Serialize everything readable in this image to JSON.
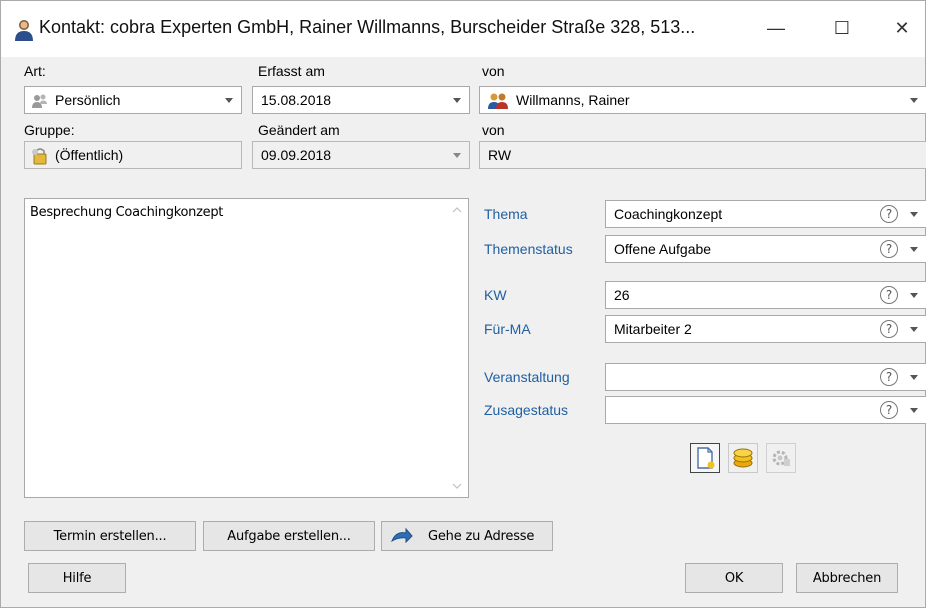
{
  "window": {
    "title": "Kontakt: cobra Experten GmbH, Rainer Willmanns, Burscheider Straße 328,  513...",
    "minimize": "—",
    "maximize": "☐",
    "close": "✕"
  },
  "header": {
    "art_label": "Art:",
    "art_value": "Persönlich",
    "erfasst_label": "Erfasst am",
    "erfasst_value": "15.08.2018",
    "von1_label": "von",
    "von1_value": "Willmanns, Rainer",
    "gruppe_label": "Gruppe:",
    "gruppe_value": "(Öffentlich)",
    "geaendert_label": "Geändert am",
    "geaendert_value": "09.09.2018",
    "von2_label": "von",
    "von2_value": "RW"
  },
  "memo": {
    "text": "Besprechung Coachingkonzept"
  },
  "fields": [
    {
      "label": "Thema",
      "value": "Coachingkonzept"
    },
    {
      "label": "Themenstatus",
      "value": "Offene Aufgabe"
    },
    {
      "label": "KW",
      "value": "26"
    },
    {
      "label": "Für-MA",
      "value": "Mitarbeiter 2"
    },
    {
      "label": "Veranstaltung",
      "value": ""
    },
    {
      "label": "Zusagestatus",
      "value": ""
    }
  ],
  "help_glyph": "?",
  "actions": {
    "termin": "Termin erstellen...",
    "aufgabe": "Aufgabe erstellen...",
    "adresse": "Gehe zu Adresse"
  },
  "footer": {
    "hilfe": "Hilfe",
    "ok": "OK",
    "abbrechen": "Abbrechen"
  },
  "icons": {
    "title": "contact-person-icon",
    "art": "persons-icon",
    "von": "users-icon",
    "gruppe": "group-lock-icon",
    "adresse": "address-arrow-icon",
    "tool1": "new-document-icon",
    "tool2": "coins-icon",
    "tool3": "gear-disabled-icon"
  }
}
